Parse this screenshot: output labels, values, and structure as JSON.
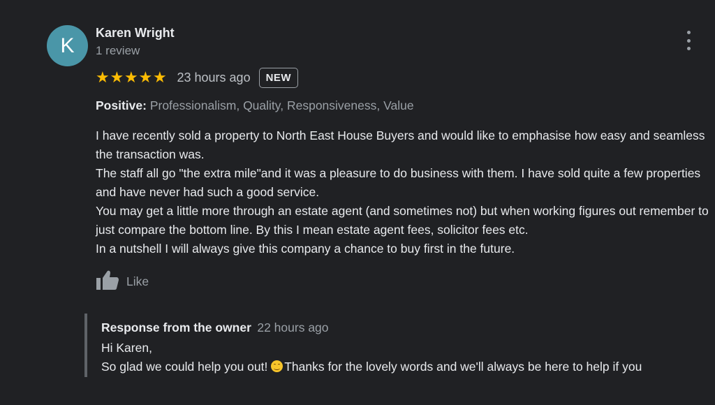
{
  "review": {
    "avatar_letter": "K",
    "reviewer_name": "Karen Wright",
    "review_count": "1 review",
    "rating": 5,
    "rating_max": 5,
    "time": "23 hours ago",
    "badge": "NEW",
    "positive_label": "Positive:",
    "positive_values": "Professionalism, Quality, Responsiveness, Value",
    "text_lines": [
      "I have recently sold a property to North East House Buyers and would like to emphasise how easy and seamless the transaction was.",
      "The staff all go \"the extra mile\"and it was a pleasure to do business with them. I have sold quite a few properties and have never had such a good service.",
      "You may get a little more through an estate agent (and sometimes not) but when working figures out remember to just compare the bottom line. By this I mean estate agent fees, solicitor fees etc.",
      "In a nutshell I will always give this company a chance to buy first in the future."
    ],
    "like_label": "Like"
  },
  "owner_response": {
    "title": "Response from the owner",
    "time": "22 hours ago",
    "greeting": "Hi Karen,",
    "body_before_emoji": "So glad we could help you out! ",
    "emoji": "smiling-face-icon",
    "body_after_emoji": "Thanks for the lovely words and we'll always be here to help if you"
  },
  "colors": {
    "background": "#202124",
    "avatar": "#4a96a8",
    "star": "#fbbc04",
    "secondary_text": "#9aa0a6"
  }
}
